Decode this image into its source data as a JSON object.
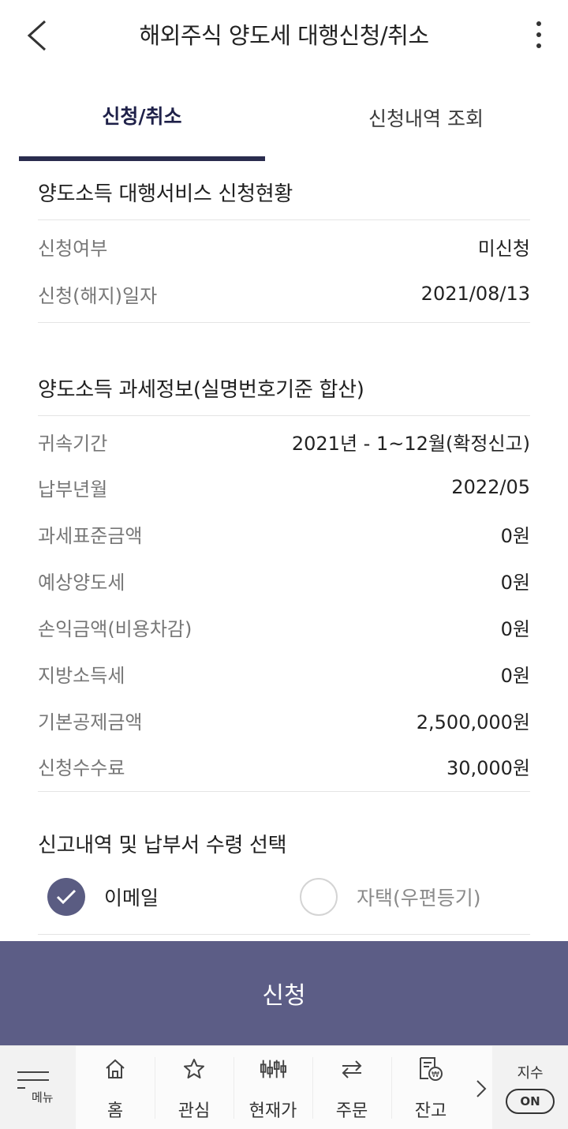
{
  "header": {
    "title": "해외주식 양도세 대행신청/취소"
  },
  "tabs": [
    {
      "label": "신청/취소"
    },
    {
      "label": "신청내역 조회"
    }
  ],
  "status": {
    "title": "양도소득 대행서비스 신청현황",
    "rows": [
      {
        "label": "신청여부",
        "value": "미신청"
      },
      {
        "label": "신청(해지)일자",
        "value": "2021/08/13"
      }
    ]
  },
  "tax": {
    "title": "양도소득 과세정보(실명번호기준 합산)",
    "rows": [
      {
        "label": "귀속기간",
        "value": "2021년 - 1~12월(확정신고)"
      },
      {
        "label": "납부년월",
        "value": "2022/05"
      },
      {
        "label": "과세표준금액",
        "value": "0원"
      },
      {
        "label": "예상양도세",
        "value": "0원"
      },
      {
        "label": "손익금액(비용차감)",
        "value": "0원"
      },
      {
        "label": "지방소득세",
        "value": "0원"
      },
      {
        "label": "기본공제금액",
        "value": "2,500,000원"
      },
      {
        "label": "신청수수료",
        "value": "30,000원"
      }
    ]
  },
  "receipt": {
    "title": "신고내역 및 납부서 수령 선택",
    "options": [
      {
        "label": "이메일",
        "selected": true
      },
      {
        "label": "자택(우편등기)",
        "selected": false
      }
    ]
  },
  "submit_label": "신청",
  "nav": {
    "menu_label": "메뉴",
    "items": [
      {
        "label": "홈",
        "icon": "home-icon"
      },
      {
        "label": "관심",
        "icon": "star-icon"
      },
      {
        "label": "현재가",
        "icon": "candlestick-icon"
      },
      {
        "label": "주문",
        "icon": "exchange-icon"
      },
      {
        "label": "잔고",
        "icon": "balance-icon"
      }
    ],
    "index_label": "지수",
    "toggle_label": "ON"
  },
  "colors": {
    "accent": "#5c5d86",
    "tab_indicator": "#2a2c4e"
  }
}
